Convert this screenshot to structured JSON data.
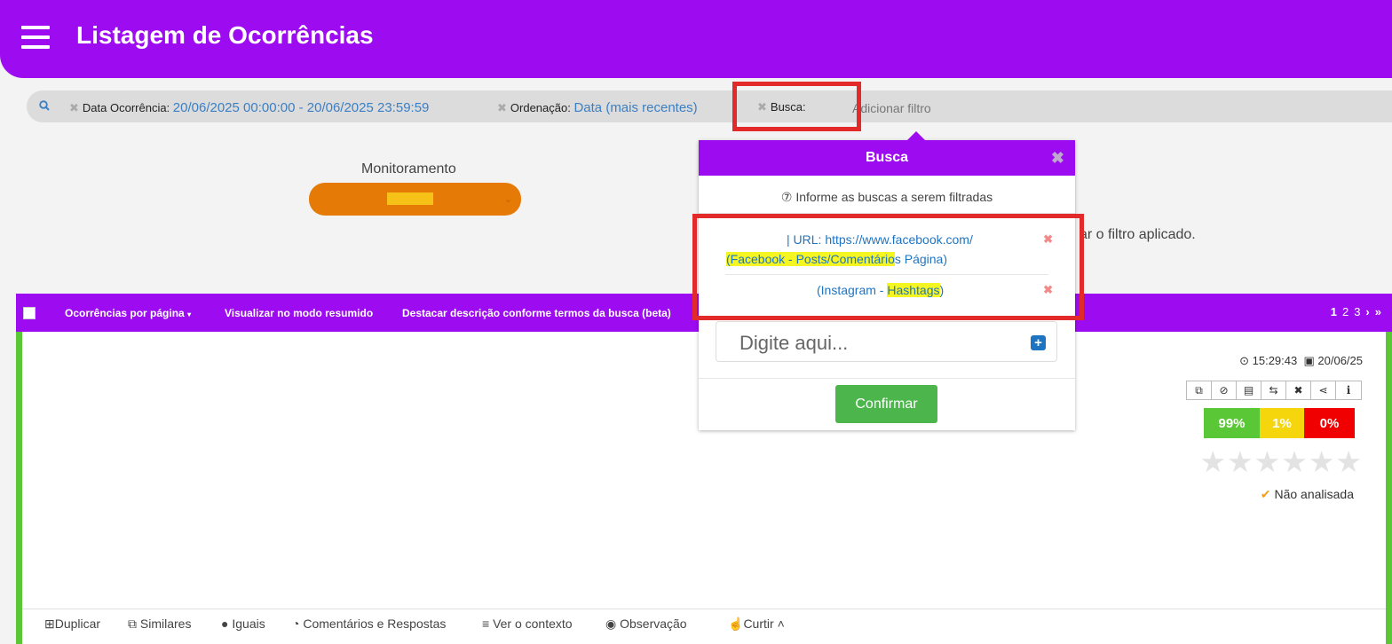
{
  "header": {
    "title": "Listagem de Ocorrências"
  },
  "filters": {
    "date_label": "Data Ocorrência:",
    "date_value": "20/06/2025 00:00:00 - 20/06/2025 23:59:59",
    "order_label": "Ordenação:",
    "order_value": "Data (mais recentes)",
    "search_label": "Busca:",
    "add_filter": "Adicionar filtro"
  },
  "monitor": {
    "label": "Monitoramento"
  },
  "background_text": "ar o filtro aplicado.",
  "toolbar": {
    "per_page": "Ocorrências por página",
    "summary_mode": "Visualizar no modo resumido",
    "highlight": "Destacar descrição conforme termos da busca (beta)",
    "pages": [
      "1",
      "2",
      "3"
    ]
  },
  "card": {
    "time": "15:29:43",
    "date": "20/06/25",
    "sentiment": [
      {
        "value": "99%",
        "color": "#5ac736"
      },
      {
        "value": "1%",
        "color": "#f5d60c"
      },
      {
        "value": "0%",
        "color": "#f00000"
      }
    ],
    "status": "Não analisada",
    "actions": [
      "Duplicar",
      "Similares",
      "Iguais",
      "Comentários e Respostas",
      "Ver o contexto",
      "Observação",
      "Curtir"
    ]
  },
  "popup": {
    "title": "Busca",
    "hint": "Informe as buscas a serem filtradas",
    "query1_line1": "| URL: https://www.facebook.com/",
    "query1_hl": "(Facebook - Posts/Comentário",
    "query1_rest": "s Página)",
    "query2_pre": "(Instagram - ",
    "query2_hl": "Hashtags",
    "query2_post": ")",
    "placeholder": "Digite aqui...",
    "confirm": "Confirmar"
  }
}
